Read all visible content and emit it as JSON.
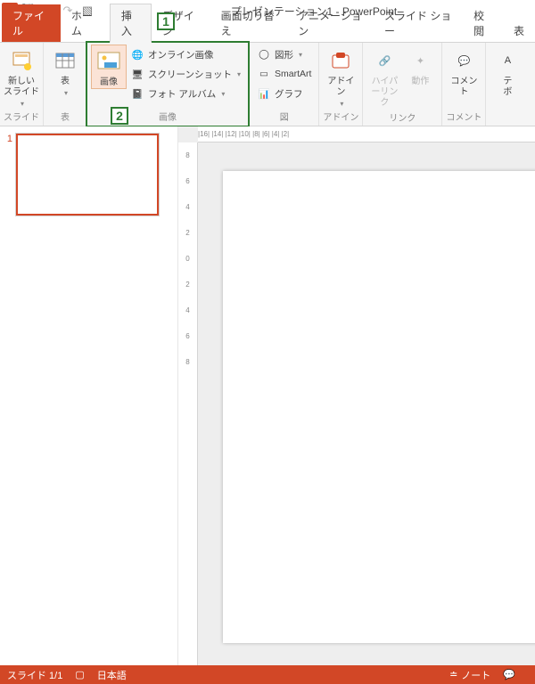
{
  "title": "プレゼンテーション1 - PowerPoint",
  "app_badge": "P",
  "tabs": {
    "file": "ファイル",
    "home": "ホーム",
    "insert": "挿入",
    "design": "デザイン",
    "transitions": "画面切り替え",
    "animations": "アニメーション",
    "slideshow": "スライド ショー",
    "review": "校閲",
    "view": "表"
  },
  "ribbon": {
    "slides": {
      "label": "スライド",
      "new_slide": "新しい\nスライド"
    },
    "tables": {
      "label": "表",
      "table": "表"
    },
    "images": {
      "label": "画像",
      "picture": "画像",
      "online": "オンライン画像",
      "screenshot": "スクリーンショット",
      "album": "フォト アルバム"
    },
    "illus": {
      "label": "図",
      "shapes": "図形",
      "smartart": "SmartArt",
      "chart": "グラフ"
    },
    "addins": {
      "label": "アドイン",
      "addins": "アドイ\nン"
    },
    "links": {
      "label": "リンク",
      "hyperlink": "ハイパーリンク",
      "action": "動作"
    },
    "comments": {
      "label": "コメント",
      "comment": "コメント"
    },
    "text": {
      "textbox": "テ\nボ"
    }
  },
  "callouts": {
    "one": "1",
    "two": "2"
  },
  "slide_number": "1",
  "ruler_h": "|16| |14| |12| |10| |8| |6| |4| |2|",
  "ruler_v": [
    "8",
    "6",
    "4",
    "2",
    "0",
    "2",
    "4",
    "6",
    "8"
  ],
  "status": {
    "slide": "スライド 1/1",
    "lang": "日本語",
    "notes": "ノート"
  }
}
